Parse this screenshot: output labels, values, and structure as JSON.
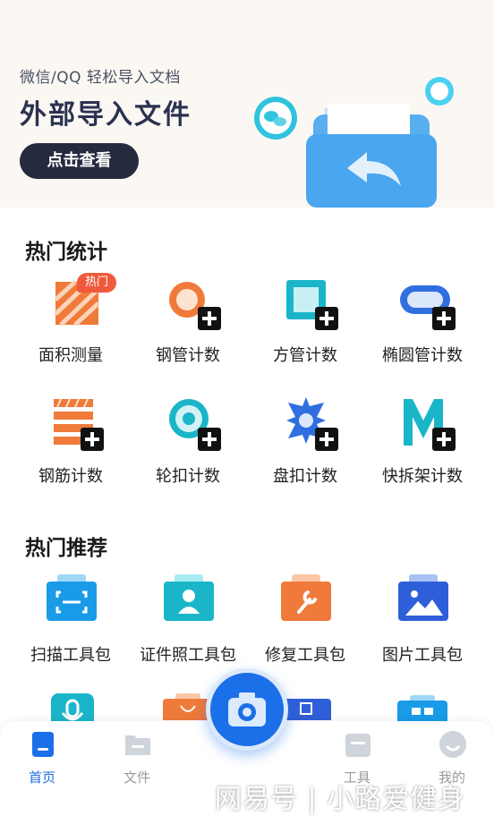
{
  "banner": {
    "subtitle": "微信/QQ 轻松导入文档",
    "title": "外部导入文件",
    "button": "点击查看"
  },
  "hot_stats": {
    "title": "热门统计",
    "badge": "热门",
    "items": [
      {
        "label": "面积测量"
      },
      {
        "label": "钢管计数"
      },
      {
        "label": "方管计数"
      },
      {
        "label": "椭圆管计数"
      },
      {
        "label": "钢筋计数"
      },
      {
        "label": "轮扣计数"
      },
      {
        "label": "盘扣计数"
      },
      {
        "label": "快拆架计数"
      }
    ]
  },
  "hot_recommend": {
    "title": "热门推荐",
    "items": [
      {
        "label": "扫描工具包"
      },
      {
        "label": "证件照工具包"
      },
      {
        "label": "修复工具包"
      },
      {
        "label": "图片工具包"
      }
    ]
  },
  "tabbar": {
    "items": [
      {
        "label": "首页",
        "icon": "home-icon"
      },
      {
        "label": "文件",
        "icon": "folder-icon"
      },
      {
        "label": "工具",
        "icon": "toolbox-icon"
      },
      {
        "label": "我的",
        "icon": "profile-icon"
      }
    ],
    "center_icon": "camera-icon"
  },
  "colors": {
    "accent": "#1b6fe8",
    "orange": "#f07a3a",
    "teal": "#1ab5c8",
    "navy": "#252a3f"
  },
  "watermark": "网易号 | 小路爱健身"
}
